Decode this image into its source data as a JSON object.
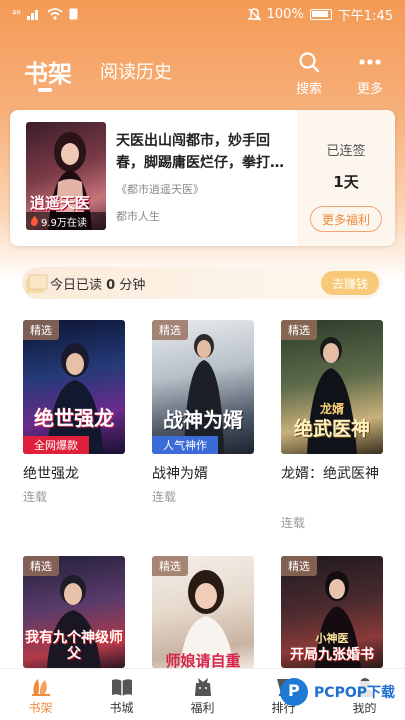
{
  "statusbar": {
    "left_signal": "⁴⁶",
    "battery_pct": "100%",
    "time": "下午1:45"
  },
  "topnav": {
    "tab_active": "书架",
    "tab_inactive": "阅读历史",
    "search_label": "搜索",
    "more_label": "更多"
  },
  "featured": {
    "cover_title": "逍遥天医",
    "cover_reads": "9.9万在读",
    "description": "天医出山闯都市，妙手回春，脚踢庸医烂仔，拳打…",
    "book_name": "《都市逍遥天医》",
    "category": "都市人生",
    "sign_label": "已连签",
    "sign_days": "1天",
    "welfare_button": "更多福利"
  },
  "readbar": {
    "prefix": "今日已读",
    "minutes": "0",
    "suffix": "分钟",
    "earn_button": "去赚钱"
  },
  "books": [
    {
      "badge": "精选",
      "cover_text": "绝世强龙",
      "cover_tag": "全网爆款",
      "title": "绝世强龙",
      "status": "连载"
    },
    {
      "badge": "精选",
      "cover_text": "战神为婿",
      "cover_tag": "人气神作",
      "title": "战神为婿",
      "status": "连载"
    },
    {
      "badge": "精选",
      "cover_text": "绝武医神",
      "cover_top": "龙婿",
      "title": "龙婿：绝武医神",
      "status": "连载"
    },
    {
      "badge": "精选",
      "cover_text": "我有九个神级师父",
      "title": "",
      "status": ""
    },
    {
      "badge": "精选",
      "cover_text": "师娘请自重",
      "title": "",
      "status": ""
    },
    {
      "badge": "精选",
      "cover_text": "开局九张婚书",
      "cover_top": "小神医",
      "title": "",
      "status": ""
    }
  ],
  "bottomnav": [
    {
      "label": "书架"
    },
    {
      "label": "书城"
    },
    {
      "label": "福利"
    },
    {
      "label": "排行"
    },
    {
      "label": "我的"
    }
  ],
  "watermark": "PCPOP下载",
  "colors": {
    "accent": "#f08a3c",
    "header": "#f49a55"
  }
}
